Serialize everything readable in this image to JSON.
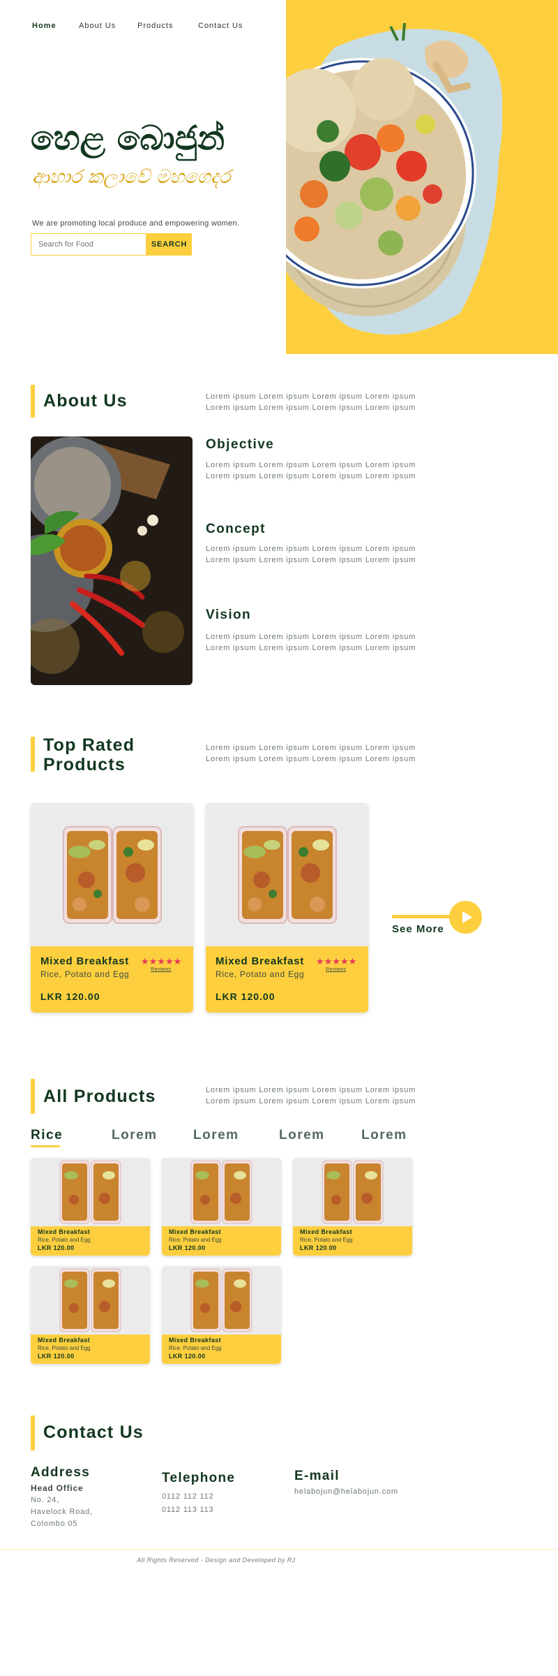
{
  "nav": {
    "items": [
      {
        "label": "Home"
      },
      {
        "label": "About Us"
      },
      {
        "label": "Products"
      },
      {
        "label": "Contact Us"
      }
    ]
  },
  "hero": {
    "title": "හෙළ බොජුන්",
    "subtitle": "ආහාර කලාවේ මහගෙදර",
    "tagline": "We are promoting local produce and empowering women.",
    "search_placeholder": "Search for Food",
    "search_button": "SEARCH"
  },
  "about": {
    "heading": "About Us",
    "intro": "Lorem ipsum Lorem ipsum Lorem ipsum Lorem ipsum Lorem ipsum Lorem ipsum  Lorem ipsum  Lorem ipsum",
    "blocks": [
      {
        "title": "Objective",
        "text": "Lorem ipsum Lorem ipsum Lorem ipsum Lorem ipsum Lorem ipsum Lorem ipsum  Lorem ipsum  Lorem ipsum"
      },
      {
        "title": "Concept",
        "text": "Lorem ipsum Lorem ipsum Lorem ipsum Lorem ipsum Lorem ipsum Lorem ipsum  Lorem ipsum  Lorem ipsum"
      },
      {
        "title": "Vision",
        "text": "Lorem ipsum Lorem ipsum Lorem ipsum Lorem ipsum Lorem ipsum Lorem ipsum  Lorem ipsum  Lorem ipsum"
      }
    ]
  },
  "top_rated": {
    "heading_line1": "Top Rated",
    "heading_line2": "Products",
    "intro": "Lorem ipsum Lorem ipsum Lorem ipsum Lorem ipsum Lorem ipsum Lorem ipsum  Lorem ipsum  Lorem ipsum",
    "products": [
      {
        "name": "Mixed Breakfast",
        "desc": "Rice, Potato and Egg",
        "price": "LKR 120.00",
        "stars": "★★★★★",
        "reviews": "Reviews",
        "rating": 5
      },
      {
        "name": "Mixed Breakfast",
        "desc": "Rice, Potato and Egg",
        "price": "LKR 120.00",
        "stars": "★★★★★",
        "reviews": "Reviews",
        "rating": 5
      }
    ],
    "see_more": "See More"
  },
  "all_products": {
    "heading": "All Products",
    "intro": "Lorem ipsum Lorem ipsum Lorem ipsum Lorem ipsum Lorem ipsum Lorem ipsum  Lorem ipsum  Lorem ipsum",
    "tabs": [
      {
        "label": "Rice"
      },
      {
        "label": "Lorem"
      },
      {
        "label": "Lorem"
      },
      {
        "label": "Lorem"
      },
      {
        "label": "Lorem"
      }
    ],
    "products": [
      {
        "name": "Mixed Breakfast",
        "desc": "Rice, Potato and Egg",
        "price": "LKR 120.00"
      },
      {
        "name": "Mixed Breakfast",
        "desc": "Rice, Potato and Egg",
        "price": "LKR 120.00"
      },
      {
        "name": "Mixed Breakfast",
        "desc": "Rice, Potato and Egg",
        "price": "LKR 120.00"
      },
      {
        "name": "Mixed Breakfast",
        "desc": "Rice, Potato and Egg",
        "price": "LKR 120.00"
      },
      {
        "name": "Mixed Breakfast",
        "desc": "Rice, Potato and Egg",
        "price": "LKR 120.00"
      }
    ]
  },
  "contact": {
    "heading": "Contact Us",
    "address_title": "Address",
    "address_office": "Head Office",
    "address_line1": "No. 24,",
    "address_line2": "Havelock Road,",
    "address_line3": "Colombo 05",
    "telephone_title": "Telephone",
    "phone1": "0112 112 112",
    "phone2": "0112 113 113",
    "email_title": "E-mail",
    "email": "helabojun@helabojun.com"
  },
  "footer": {
    "text": "All Rights Reserved - Design and Developed by RJ"
  },
  "colors": {
    "accent": "#fdcf3f",
    "primary": "#12371f",
    "star": "#e6385b",
    "muted": "#6d7a72"
  }
}
